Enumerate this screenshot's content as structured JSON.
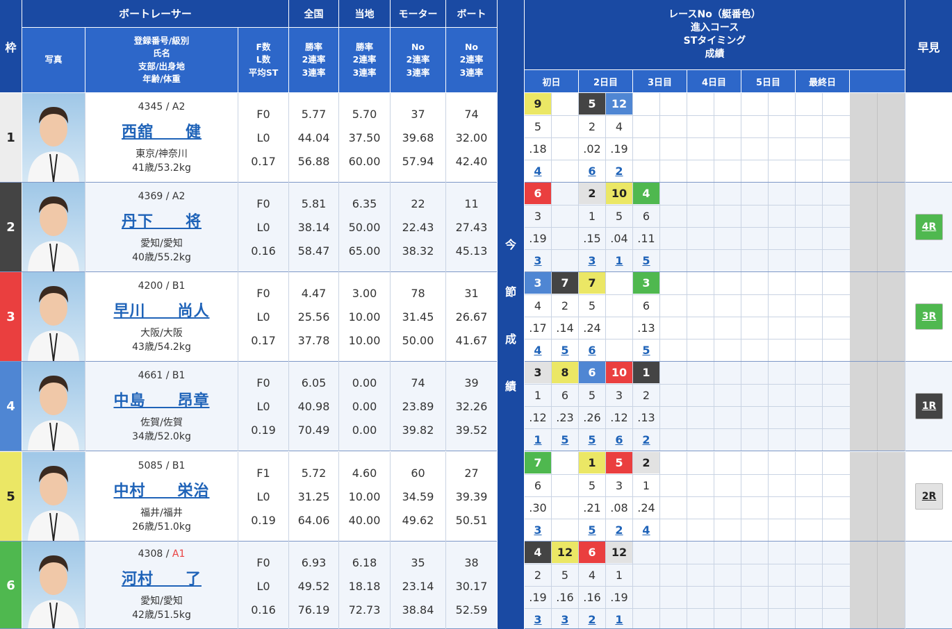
{
  "header": {
    "waku": "枠",
    "boat_racer": "ボートレーサー",
    "photo": "写真",
    "reg_info": [
      "登録番号/級別",
      "氏名",
      "支部/出身地",
      "年齢/体重"
    ],
    "f_info": [
      "F数",
      "L数",
      "平均ST"
    ],
    "zenkoku": "全国",
    "touchi": "当地",
    "motor": "モーター",
    "boat": "ボート",
    "rate3": [
      "勝率",
      "2連率",
      "3連率"
    ],
    "no3": [
      "No",
      "2連率",
      "3連率"
    ],
    "race_info": [
      "レースNo（艇番色）",
      "進入コース",
      "STタイミング",
      "成績"
    ],
    "hayami": "早見",
    "konsetsu": [
      "今",
      "節",
      "成",
      "績"
    ],
    "days": [
      "初日",
      "2日目",
      "3日目",
      "4日目",
      "5日目",
      "最終日"
    ]
  },
  "colors": {
    "header_dark": "#1a4aa3",
    "header_light": "#2d67c9",
    "link": "#1f63b8"
  },
  "racers": [
    {
      "waku": "1",
      "waku_color": "#ededed",
      "waku_text": "#222",
      "reg": "4345 / A2",
      "class_a1": false,
      "name": "西舘　　健",
      "branch": "東京/神奈川",
      "age_weight": "41歳/53.2kg",
      "f": "F0",
      "l": "L0",
      "st": "0.17",
      "z": [
        "5.77",
        "44.04",
        "56.88"
      ],
      "t": [
        "5.70",
        "37.50",
        "60.00"
      ],
      "m": [
        "37",
        "39.68",
        "57.94"
      ],
      "b": [
        "74",
        "32.00",
        "42.40"
      ],
      "hayami": "",
      "races": [
        {
          "col": 0,
          "no": "9",
          "cls": "b9",
          "course": "5",
          "st": ".18",
          "res": "4"
        },
        {
          "col": 2,
          "no": "5",
          "cls": "bk",
          "course": "2",
          "st": ".02",
          "res": "6"
        },
        {
          "col": 3,
          "no": "12",
          "cls": "b12",
          "course": "4",
          "st": ".19",
          "res": "2"
        }
      ]
    },
    {
      "waku": "2",
      "waku_color": "#444444",
      "waku_text": "#fff",
      "reg": "4369 / A2",
      "class_a1": false,
      "name": "丹下　　将",
      "branch": "愛知/愛知",
      "age_weight": "40歳/55.2kg",
      "f": "F0",
      "l": "L0",
      "st": "0.16",
      "z": [
        "5.81",
        "38.14",
        "58.47"
      ],
      "t": [
        "6.35",
        "50.00",
        "65.00"
      ],
      "m": [
        "22",
        "22.43",
        "38.32"
      ],
      "b": [
        "11",
        "27.43",
        "45.13"
      ],
      "hayami": "4R",
      "hayami_color": "#4fb84f",
      "hayami_text": "#fff",
      "races": [
        {
          "col": 0,
          "no": "6",
          "cls": "b3",
          "course": "3",
          "st": ".19",
          "res": "3"
        },
        {
          "col": 2,
          "no": "2",
          "cls": "b2",
          "course": "1",
          "st": ".15",
          "res": "3"
        },
        {
          "col": 3,
          "no": "10",
          "cls": "b5",
          "course": "5",
          "st": ".04",
          "res": "1"
        },
        {
          "col": 4,
          "no": "4",
          "cls": "b6",
          "course": "6",
          "st": ".11",
          "res": "5"
        }
      ]
    },
    {
      "waku": "3",
      "waku_color": "#ea3f3f",
      "waku_text": "#fff",
      "reg": "4200 / B1",
      "class_a1": false,
      "name": "早川　　尚人",
      "branch": "大阪/大阪",
      "age_weight": "43歳/54.2kg",
      "f": "F0",
      "l": "L0",
      "st": "0.17",
      "z": [
        "4.47",
        "25.56",
        "37.78"
      ],
      "t": [
        "3.00",
        "10.00",
        "10.00"
      ],
      "m": [
        "78",
        "31.45",
        "50.00"
      ],
      "b": [
        "31",
        "26.67",
        "41.67"
      ],
      "hayami": "3R",
      "hayami_color": "#4fb84f",
      "hayami_text": "#fff",
      "races": [
        {
          "col": 0,
          "no": "3",
          "cls": "b4",
          "course": "4",
          "st": ".17",
          "res": "4"
        },
        {
          "col": 1,
          "no": "7",
          "cls": "bk",
          "course": "2",
          "st": ".14",
          "res": "5"
        },
        {
          "col": 2,
          "no": "7",
          "cls": "b5",
          "course": "5",
          "st": ".24",
          "res": "6"
        },
        {
          "col": 4,
          "no": "3",
          "cls": "b6",
          "course": "6",
          "st": ".13",
          "res": "5"
        }
      ]
    },
    {
      "waku": "4",
      "waku_color": "#4f86d3",
      "waku_text": "#fff",
      "reg": "4661 / B1",
      "class_a1": false,
      "name": "中島　　昂章",
      "branch": "佐賀/佐賀",
      "age_weight": "34歳/52.0kg",
      "f": "F0",
      "l": "L0",
      "st": "0.19",
      "z": [
        "6.05",
        "40.98",
        "70.49"
      ],
      "t": [
        "0.00",
        "0.00",
        "0.00"
      ],
      "m": [
        "74",
        "23.89",
        "39.82"
      ],
      "b": [
        "39",
        "32.26",
        "39.52"
      ],
      "hayami": "1R",
      "hayami_color": "#444444",
      "hayami_text": "#fff",
      "races": [
        {
          "col": 0,
          "no": "3",
          "cls": "b2",
          "course": "1",
          "st": ".12",
          "res": "1"
        },
        {
          "col": 1,
          "no": "8",
          "cls": "b5",
          "course": "6",
          "st": ".23",
          "res": "5"
        },
        {
          "col": 2,
          "no": "6",
          "cls": "b4",
          "course": "5",
          "st": ".26",
          "res": "5"
        },
        {
          "col": 3,
          "no": "10",
          "cls": "b3",
          "course": "3",
          "st": ".12",
          "res": "6"
        },
        {
          "col": 4,
          "no": "1",
          "cls": "bk",
          "course": "2",
          "st": ".13",
          "res": "2"
        }
      ]
    },
    {
      "waku": "5",
      "waku_color": "#ebe765",
      "waku_text": "#222",
      "reg": "5085 / B1",
      "class_a1": false,
      "name": "中村　　栄治",
      "branch": "福井/福井",
      "age_weight": "26歳/51.0kg",
      "f": "F1",
      "l": "L0",
      "st": "0.19",
      "z": [
        "5.72",
        "31.25",
        "64.06"
      ],
      "t": [
        "4.60",
        "10.00",
        "40.00"
      ],
      "m": [
        "60",
        "34.59",
        "49.62"
      ],
      "b": [
        "27",
        "39.39",
        "50.51"
      ],
      "hayami": "2R",
      "hayami_color": "#e2e2e2",
      "hayami_text": "#222",
      "races": [
        {
          "col": 0,
          "no": "7",
          "cls": "b6",
          "course": "6",
          "st": ".30",
          "res": "3"
        },
        {
          "col": 2,
          "no": "1",
          "cls": "b5",
          "course": "5",
          "st": ".21",
          "res": "5"
        },
        {
          "col": 3,
          "no": "5",
          "cls": "b3",
          "course": "3",
          "st": ".08",
          "res": "2"
        },
        {
          "col": 4,
          "no": "2",
          "cls": "b2",
          "course": "1",
          "st": ".24",
          "res": "4"
        }
      ]
    },
    {
      "waku": "6",
      "waku_color": "#4fb84f",
      "waku_text": "#fff",
      "reg": "4308 / ",
      "class": "A1",
      "class_a1": true,
      "name": "河村　　了",
      "branch": "愛知/愛知",
      "age_weight": "42歳/51.5kg",
      "f": "F0",
      "l": "L0",
      "st": "0.16",
      "z": [
        "6.93",
        "49.52",
        "76.19"
      ],
      "t": [
        "6.18",
        "18.18",
        "72.73"
      ],
      "m": [
        "35",
        "23.14",
        "38.84"
      ],
      "b": [
        "38",
        "30.17",
        "52.59"
      ],
      "hayami": "",
      "races": [
        {
          "col": 0,
          "no": "4",
          "cls": "bk",
          "course": "2",
          "st": ".19",
          "res": "3"
        },
        {
          "col": 1,
          "no": "12",
          "cls": "b5",
          "course": "5",
          "st": ".16",
          "res": "3"
        },
        {
          "col": 2,
          "no": "6",
          "cls": "b3",
          "course": "4",
          "st": ".16",
          "res": "2"
        },
        {
          "col": 3,
          "no": "12",
          "cls": "b2",
          "course": "1",
          "st": ".19",
          "res": "1"
        }
      ]
    }
  ]
}
